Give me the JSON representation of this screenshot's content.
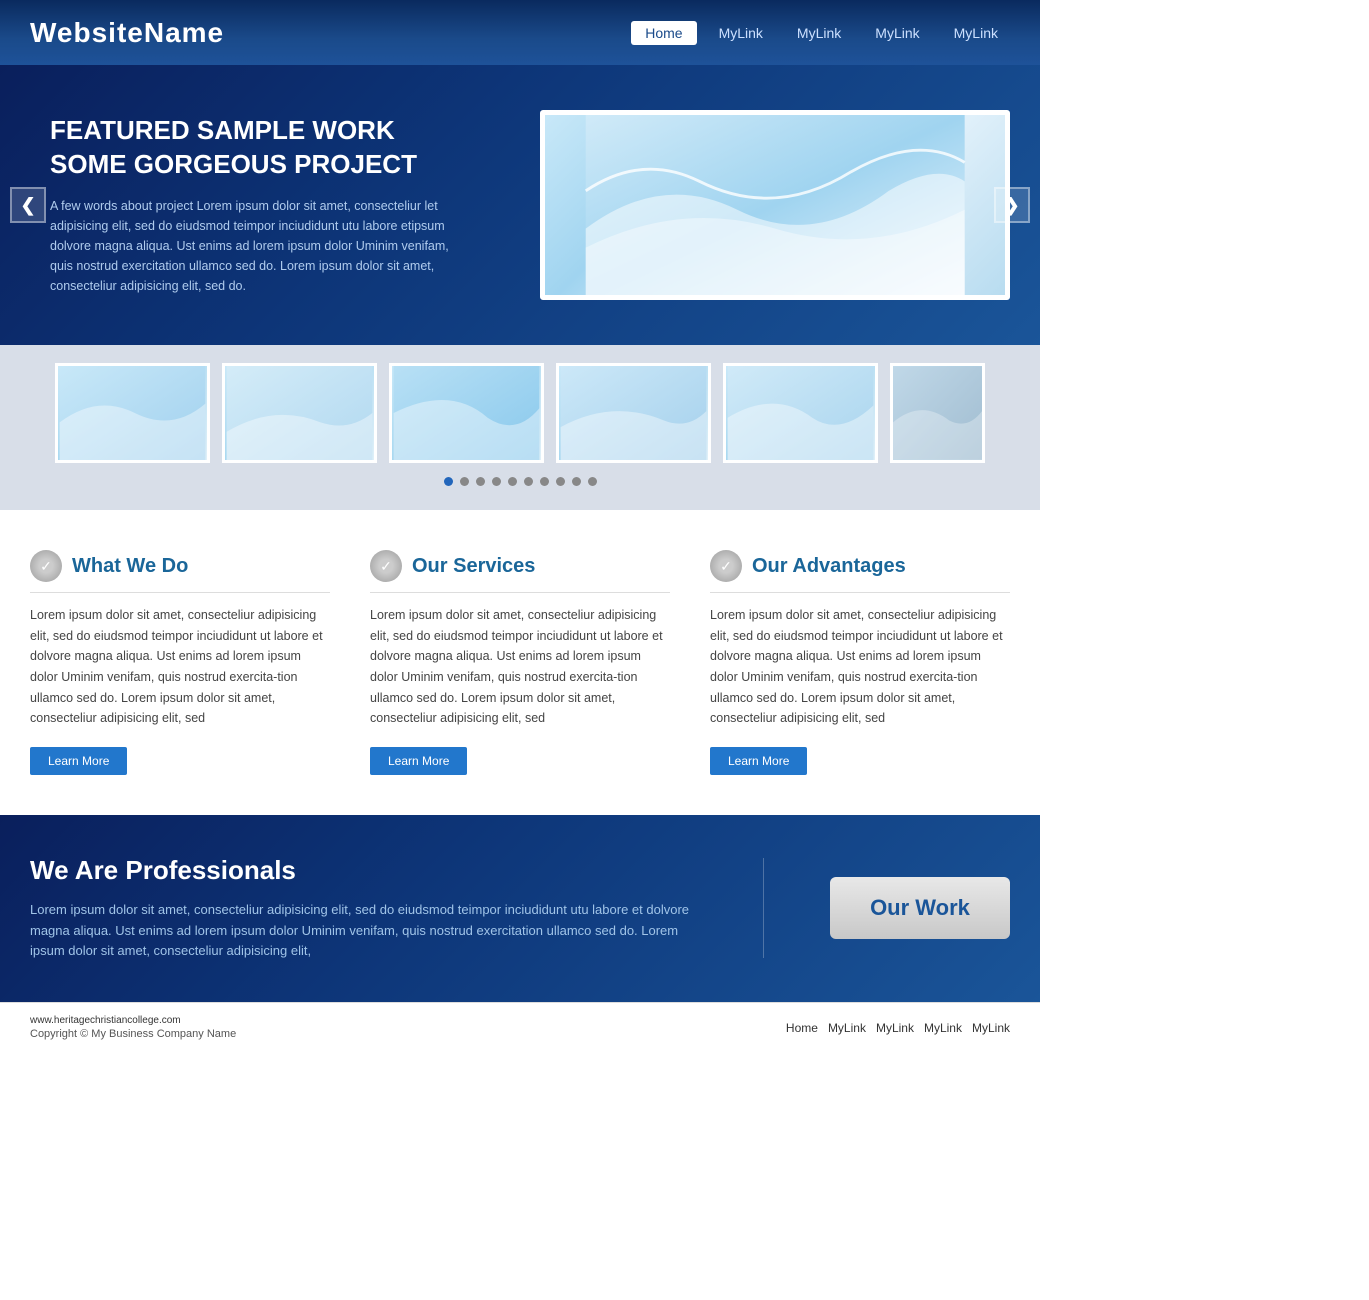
{
  "header": {
    "site_name": "WebsiteName",
    "nav": {
      "home": "Home",
      "link1": "MyLink",
      "link2": "MyLink",
      "link3": "MyLink",
      "link4": "MyLink"
    }
  },
  "hero": {
    "prev_label": "❮",
    "next_label": "❯",
    "title_line1": "FEATURED SAMPLE WORK",
    "title_line2": "SOME GORGEOUS PROJECT",
    "description": "A few words about project Lorem ipsum dolor sit amet, consecteliur let adipisicing elit, sed do eiudsmod teimpor inciudidunt utu labore etipsum dolvore magna aliqua. Ust enims ad lorem ipsum dolor Uminim venifam, quis nostrud exercitation ullamco sed do. Lorem ipsum dolor sit amet, consecteliur adipisicing elit, sed do."
  },
  "thumbstrip": {
    "dots_count": 10,
    "active_dot": 0
  },
  "columns": [
    {
      "id": "what-we-do",
      "title": "What We Do",
      "body": "Lorem ipsum dolor sit amet, consecteliur adipisicing elit, sed do eiudsmod teimpor inciudidunt ut labore et dolvore magna aliqua. Ust enims ad lorem ipsum dolor Uminim venifam, quis nostrud exercita-tion ullamco sed do. Lorem ipsum dolor sit amet, consecteliur adipisicing elit, sed",
      "btn_label": "Learn More"
    },
    {
      "id": "our-services",
      "title": "Our Services",
      "body": "Lorem ipsum dolor sit amet, consecteliur adipisicing elit, sed do eiudsmod teimpor inciudidunt ut labore et dolvore magna aliqua. Ust enims ad lorem ipsum dolor Uminim venifam, quis nostrud exercita-tion ullamco sed do. Lorem ipsum dolor sit amet, consecteliur adipisicing elit, sed",
      "btn_label": "Learn More"
    },
    {
      "id": "our-advantages",
      "title": "Our Advantages",
      "body": "Lorem ipsum dolor sit amet, consecteliur adipisicing elit, sed do eiudsmod teimpor inciudidunt ut labore et dolvore magna aliqua. Ust enims ad lorem ipsum dolor Uminim venifam, quis nostrud exercita-tion ullamco sed do. Lorem ipsum dolor sit amet, consecteliur adipisicing elit, sed",
      "btn_label": "Learn More"
    }
  ],
  "cta": {
    "title": "We Are Professionals",
    "description": "Lorem ipsum dolor sit amet, consecteliur adipisicing elit, sed do eiudsmod teimpor inciudidunt utu labore et dolvore magna aliqua. Ust enims ad lorem ipsum dolor Uminim venifam, quis nostrud exercitation ullamco sed do. Lorem ipsum dolor sit amet, consecteliur adipisicing elit,",
    "btn_label": "Our Work"
  },
  "footer": {
    "url": "www.heritagechristiancollege.com",
    "copyright": "Copyright © My Business Company Name",
    "nav": {
      "home": "Home",
      "link1": "MyLink",
      "link2": "MyLink",
      "link3": "MyLink",
      "link4": "MyLink"
    }
  }
}
